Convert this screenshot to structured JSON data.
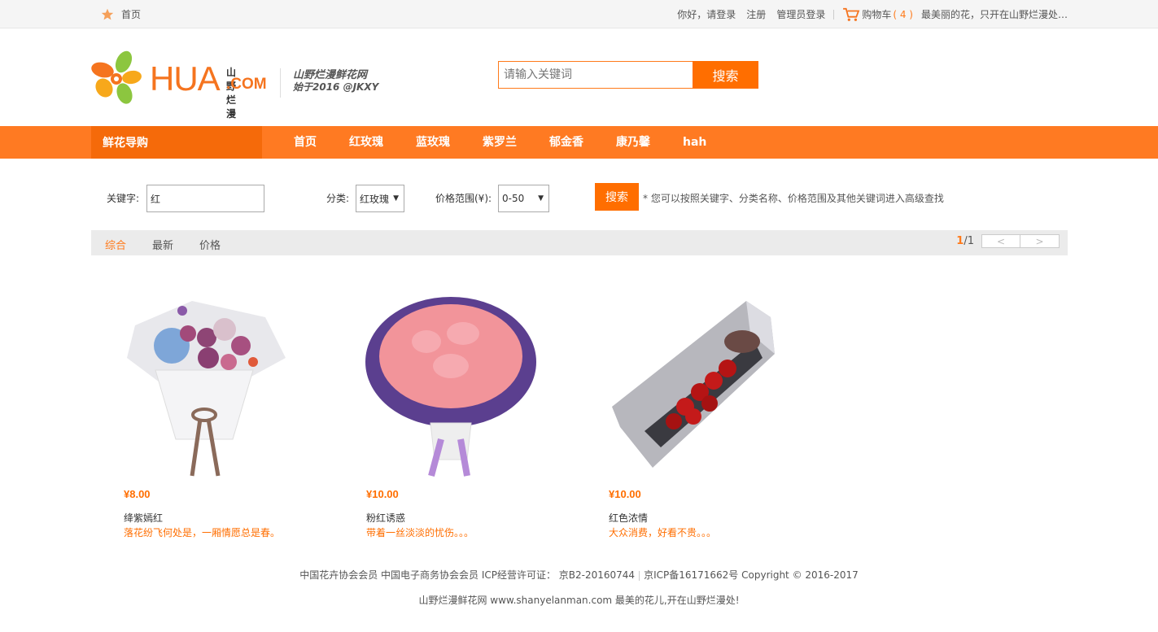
{
  "topbar": {
    "home": "首页",
    "greeting": "你好，请登录",
    "register": "注册",
    "admin_login": "管理员登录",
    "cart_label": "购物车",
    "cart_count": "( 4 )",
    "slogan": "最美丽的花，只开在山野烂漫处…"
  },
  "header": {
    "logo_text": "HUA",
    "logo_cn": "山野烂漫",
    "logo_com": ".COM",
    "tagline1": "山野烂漫鲜花网",
    "tagline2": "始于2016 @JKXY",
    "search_placeholder": "请输入关键词",
    "search_button": "搜索"
  },
  "nav": {
    "guide": "鲜花导购",
    "items": [
      "首页",
      "红玫瑰",
      "蓝玫瑰",
      "紫罗兰",
      "郁金香",
      "康乃馨",
      "hah"
    ]
  },
  "filter": {
    "keyword_label": "关键字:",
    "keyword_value": "红",
    "category_label": "分类:",
    "category_value": "红玫瑰",
    "price_label": "价格范围(¥):",
    "price_value": "0-50",
    "search_button": "搜索",
    "tip": "* 您可以按照关键字、分类名称、价格范围及其他关键词进入高级查找"
  },
  "sortbar": {
    "tabs": [
      "综合",
      "最新",
      "价格"
    ],
    "page_current": "1",
    "page_total": "/1",
    "prev": "<",
    "next": ">"
  },
  "products": [
    {
      "price": "¥8.00",
      "name": "绛紫嫣红",
      "desc": "落花纷飞何处是，一厢情愿总是春。"
    },
    {
      "price": "¥10.00",
      "name": "粉红诱惑",
      "desc": "带着一丝淡淡的忧伤。。。"
    },
    {
      "price": "¥10.00",
      "name": "红色浓情",
      "desc": "大众消费，好看不贵。。。"
    }
  ],
  "footer": {
    "line1a": "中国花卉协会会员 中国电子商务协会会员 ICP经营许可证： 京B2-20160744",
    "line1b": "京ICP备16171662号 Copyright © 2016-2017",
    "line2": "山野烂漫鲜花网 www.shanyelanman.com 最美的花儿,开在山野烂漫处!"
  },
  "colors": {
    "accent": "#ff7a22",
    "accent_dark": "#f56a0a",
    "price": "#ff6e00"
  }
}
